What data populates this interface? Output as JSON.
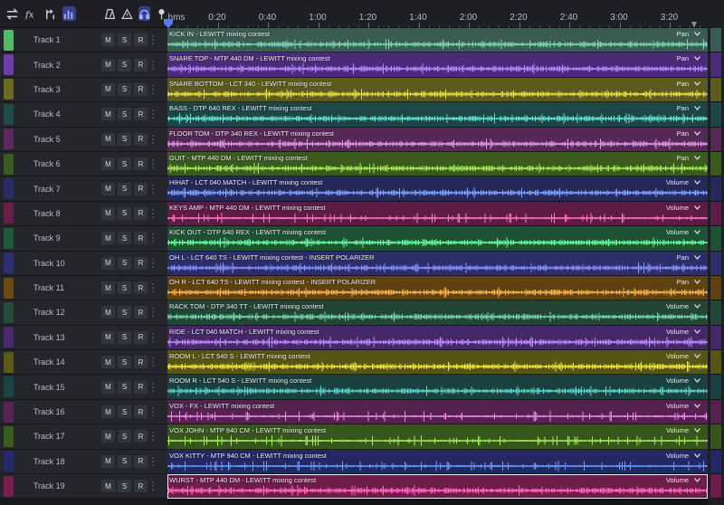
{
  "toolbar": {
    "icons": [
      {
        "name": "swap-arrows-icon",
        "glyph": "⇄"
      },
      {
        "name": "fx-icon",
        "glyph": "fx"
      },
      {
        "name": "branch-icon",
        "glyph": "⤴"
      },
      {
        "name": "bar-meter-icon",
        "glyph": "▮"
      },
      {
        "name": "metronome-icon",
        "glyph": "△"
      },
      {
        "name": "warning-icon",
        "glyph": "⚠"
      },
      {
        "name": "headphones-icon",
        "glyph": "∩"
      },
      {
        "name": "microphone-icon",
        "glyph": "⚲"
      }
    ]
  },
  "ruler": {
    "origin_label": "hms",
    "labels": [
      "0:20",
      "0:40",
      "1:00",
      "1:20",
      "1:40",
      "2:00",
      "2:20",
      "2:40",
      "3:00",
      "3:20"
    ]
  },
  "buttons": {
    "mute": "M",
    "solo": "S",
    "record": "R"
  },
  "tracks": [
    {
      "name": "Track 1",
      "color": "#58b86a",
      "clip": "KICK IN - LEWITT mixing contest",
      "param": "Pan",
      "clip_color": "#3a5c52",
      "wave_color": "#7fd9b8"
    },
    {
      "name": "Track 2",
      "color": "#6c3fa6",
      "clip": "SNARE TOP - MTP 440 DM - LEWITT mixing contest",
      "param": "Pan",
      "clip_color": "#4c2a7a",
      "wave_color": "#b58cff"
    },
    {
      "name": "Track 3",
      "color": "#6c6a22",
      "clip": "SNARE BOTTOM - LCT 340 - LEWITT mixing contest",
      "param": "Pan",
      "clip_color": "#5c5a1c",
      "wave_color": "#e8e24a"
    },
    {
      "name": "Track 4",
      "color": "#1f4a4a",
      "clip": "BASS - DTP 640 REX - LEWITT mixing contest",
      "param": "Pan",
      "clip_color": "#1d4646",
      "wave_color": "#6ce0d6"
    },
    {
      "name": "Track 5",
      "color": "#5a2a5e",
      "clip": "FLOOR TOM - DTP 340 REX - LEWITT mixing contest",
      "param": "Pan",
      "clip_color": "#552856",
      "wave_color": "#e79ae6"
    },
    {
      "name": "Track 6",
      "color": "#3d5a22",
      "clip": "GUIT - MTP 440 DM - LEWITT mixing contest",
      "param": "Pan",
      "clip_color": "#3a5a1e",
      "wave_color": "#a8ee5a"
    },
    {
      "name": "Track 7",
      "color": "#2a2c66",
      "clip": "HIHAT - LCT 040 MATCH - LEWITT mixing contest",
      "param": "Volume",
      "clip_color": "#25295a",
      "wave_color": "#7fa4ff"
    },
    {
      "name": "Track 8",
      "color": "#6a1f4a",
      "clip": "KEYS AMP - MTP 440 DM - LEWITT mixing contest",
      "param": "Volume",
      "clip_color": "#5e1c44",
      "wave_color": "#ff7cc4"
    },
    {
      "name": "Track 9",
      "color": "#1f5a3a",
      "clip": "KICK OUT - DTP 640 REX - LEWITT mixing contest",
      "param": "Volume",
      "clip_color": "#1e5234",
      "wave_color": "#6aff9c"
    },
    {
      "name": "Track 10",
      "color": "#2e2f70",
      "clip": "OH L - LCT 640 TS - LEWITT mixing contest - INSERT POLARIZER",
      "param": "Pan",
      "clip_color": "#2c2e6a",
      "wave_color": "#8a92ff"
    },
    {
      "name": "Track 11",
      "color": "#6a4a14",
      "clip": "OH R - LCT 640 TS - LEWITT mixing contest - INSERT POLARIZER",
      "param": "Pan",
      "clip_color": "#5e4212",
      "wave_color": "#ffb24a"
    },
    {
      "name": "Track 12",
      "color": "#234a3c",
      "clip": "RACK TOM - DTP 340 TT - LEWITT mixing contest",
      "param": "Volume",
      "clip_color": "#224536",
      "wave_color": "#7ad8b0"
    },
    {
      "name": "Track 13",
      "color": "#4a2a6e",
      "clip": "RIDE - LCT 040 MATCH - LEWITT mixing contest",
      "param": "Volume",
      "clip_color": "#452866",
      "wave_color": "#c08aff"
    },
    {
      "name": "Track 14",
      "color": "#5c5a18",
      "clip": "ROOM L - LCT 540 S - LEWITT mixing contest",
      "param": "Volume",
      "clip_color": "#585616",
      "wave_color": "#f2ea3c"
    },
    {
      "name": "Track 15",
      "color": "#1d4444",
      "clip": "ROOM R - LCT 540 S - LEWITT mixing contest",
      "param": "Volume",
      "clip_color": "#1b4040",
      "wave_color": "#5ed4cc"
    },
    {
      "name": "Track 16",
      "color": "#5a2356",
      "clip": "VOX - FX - LEWITT mixing contest",
      "param": "Volume",
      "clip_color": "#55214f",
      "wave_color": "#f08ae8"
    },
    {
      "name": "Track 17",
      "color": "#3a5a1e",
      "clip": "VOX JOHN - MTP 940 CM - LEWITT mixing contest",
      "param": "Volume",
      "clip_color": "#37561c",
      "wave_color": "#a2f052"
    },
    {
      "name": "Track 18",
      "color": "#252a6a",
      "clip": "VOX KITTY - MTP 940 CM - LEWITT mixing contest",
      "param": "Volume",
      "clip_color": "#232862",
      "wave_color": "#6c9cff"
    },
    {
      "name": "Track 19",
      "color": "#7a1f52",
      "clip": "WURST - MTP 440 DM - LEWITT mixing contest",
      "param": "Volume",
      "clip_color": "#6e1c4a",
      "wave_color": "#ff6cc2"
    }
  ]
}
